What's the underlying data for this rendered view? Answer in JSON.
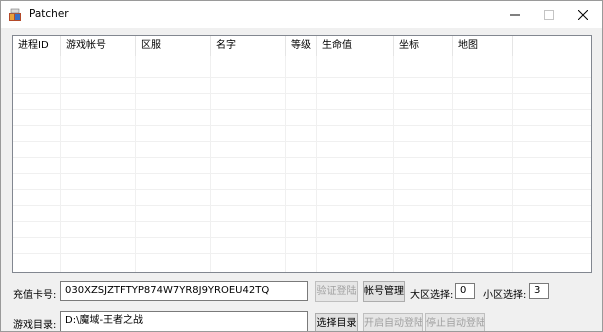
{
  "window": {
    "title": "Patcher",
    "icons": {
      "app": "app-icon",
      "minimize": "minimize-icon",
      "maximize": "maximize-icon",
      "close": "close-icon"
    }
  },
  "table": {
    "columns": [
      "进程ID",
      "游戏帐号",
      "区服",
      "名字",
      "等级",
      "生命值",
      "坐标",
      "地图"
    ],
    "rows": []
  },
  "form": {
    "card_label": "充值卡号:",
    "card_value": "030XZSJZTFTYP874W7YR8J9YROEU42TQ",
    "verify_label": "验证登陆",
    "account_label": "帐号管理",
    "big_zone_label": "大区选择:",
    "big_zone_value": "0",
    "small_zone_label": "小区选择:",
    "small_zone_value": "3",
    "dir_label": "游戏目录:",
    "dir_value": "D:\\魔域-王者之战",
    "select_dir_label": "选择目录",
    "start_auto_label": "开启自动登陆",
    "stop_auto_label": "停止自动登陆"
  }
}
